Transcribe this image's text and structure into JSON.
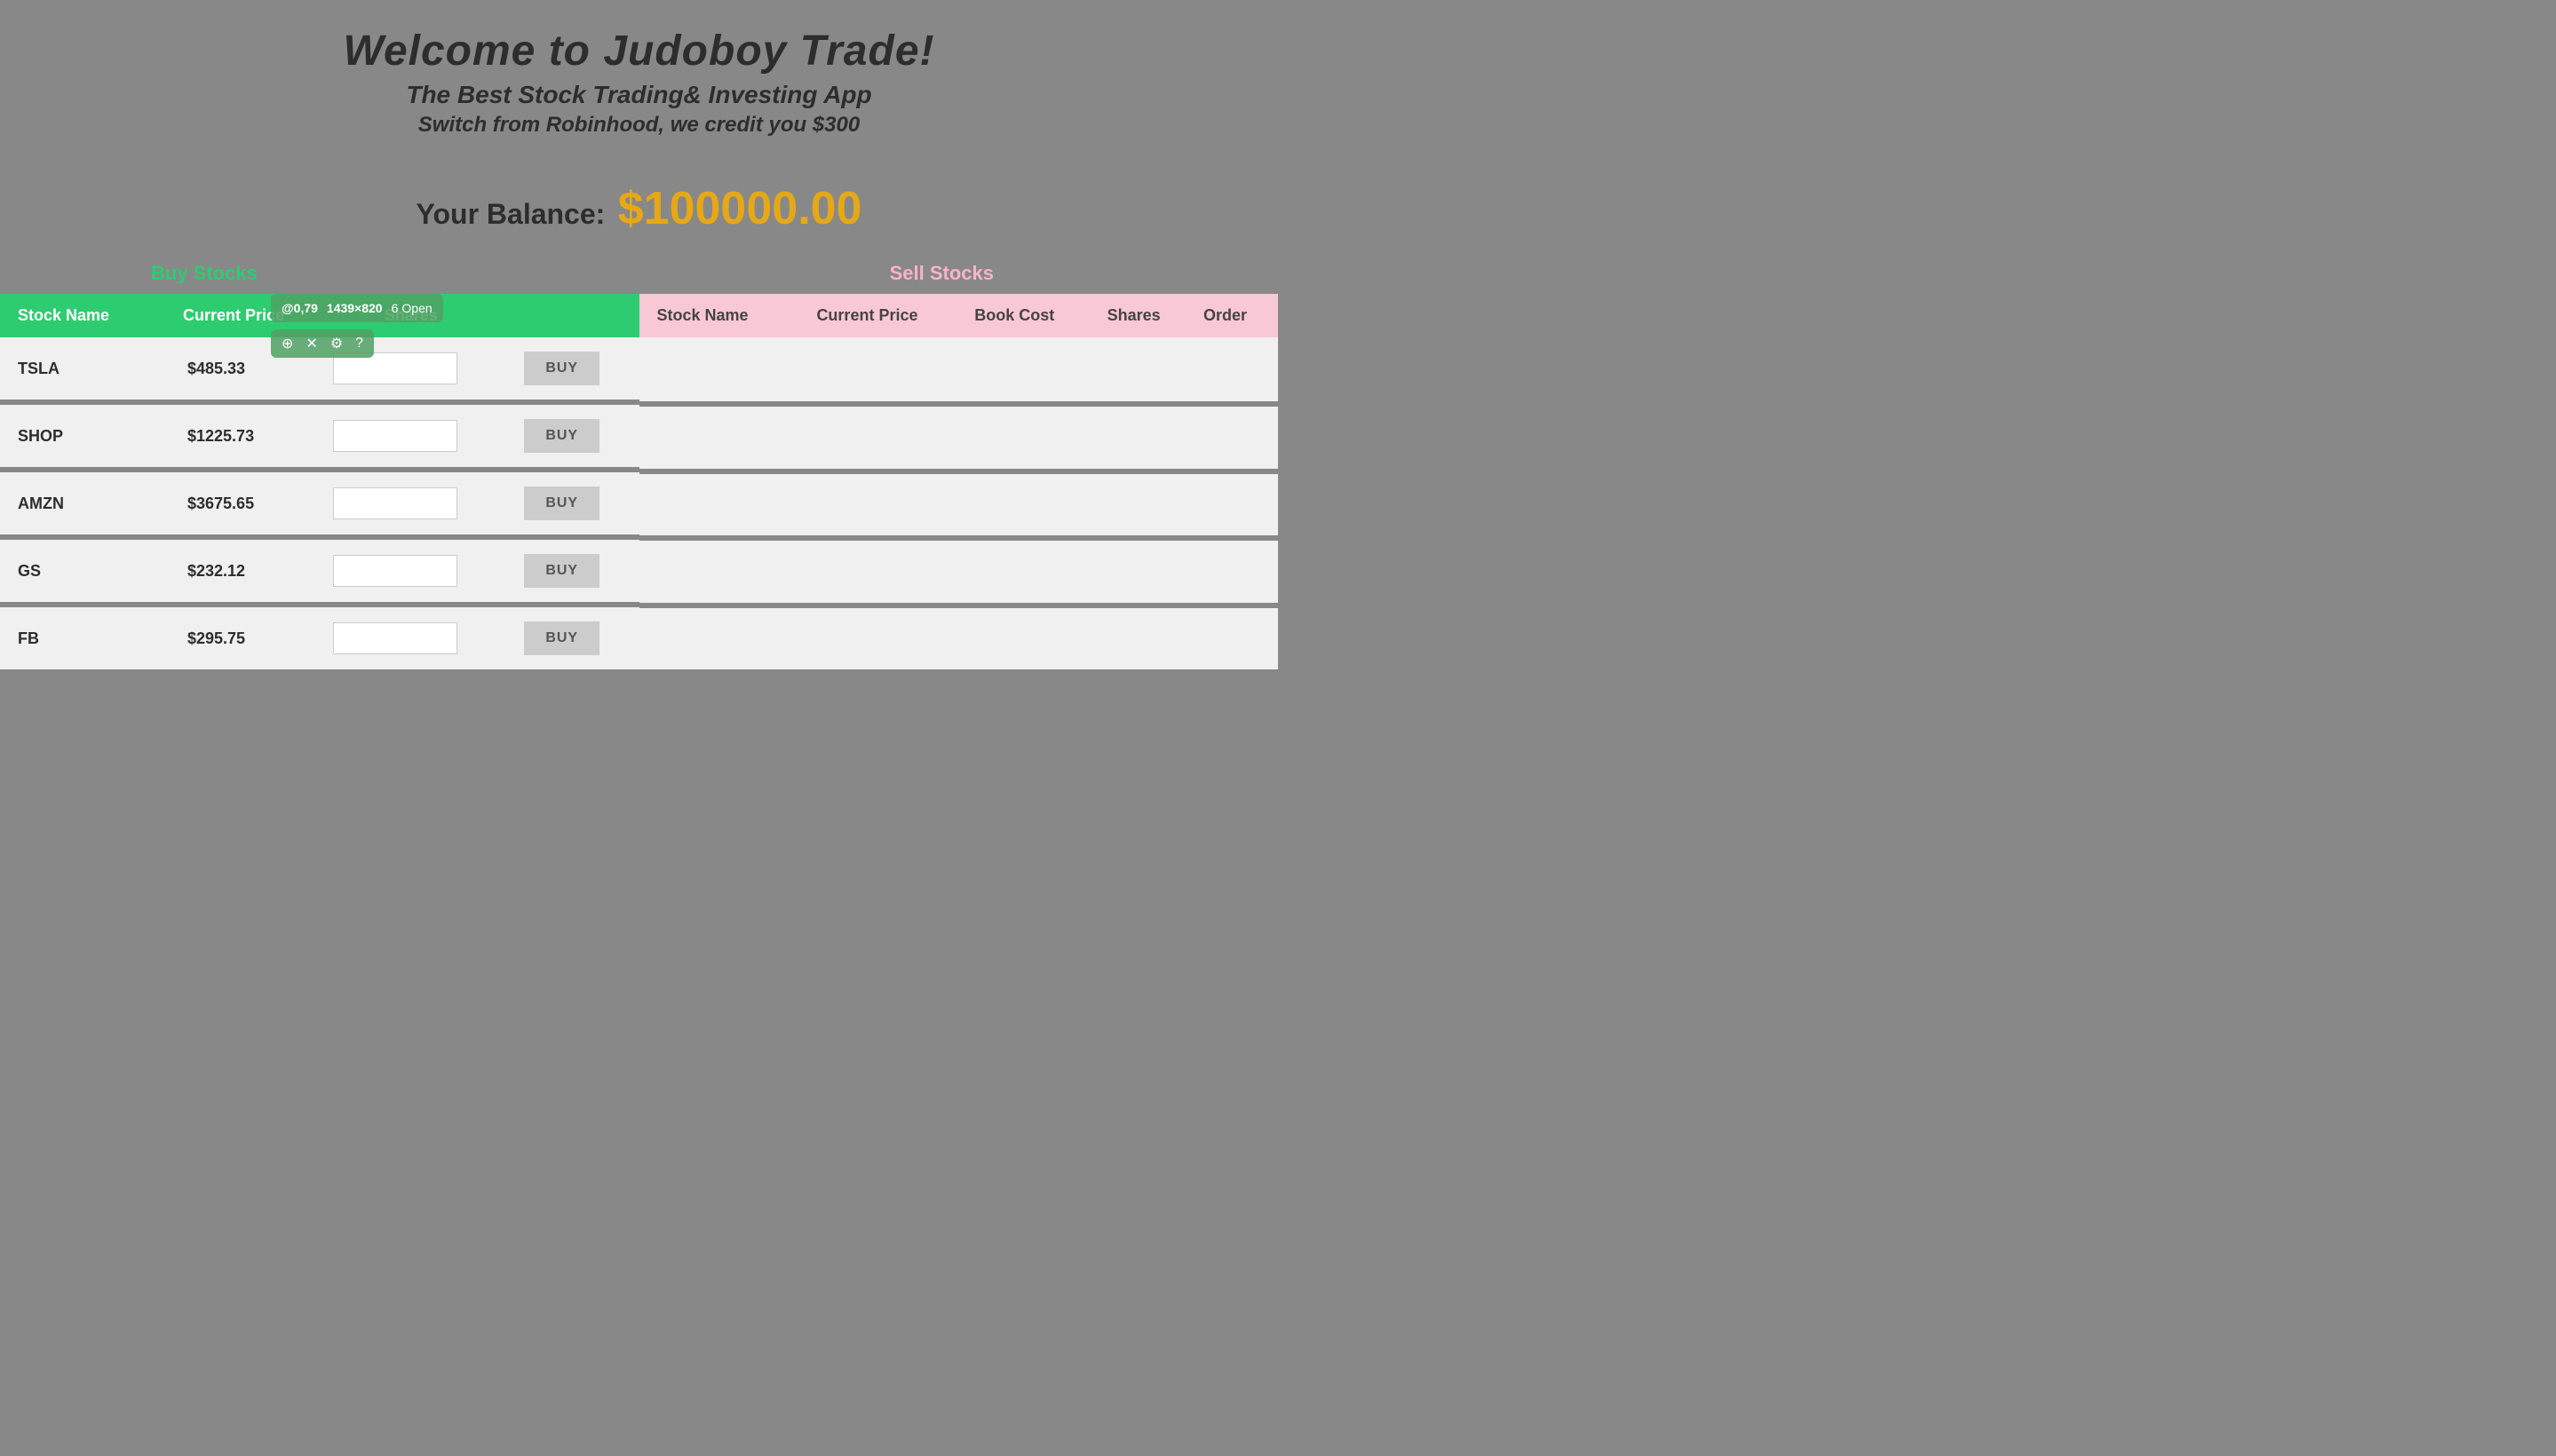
{
  "header": {
    "title": "Welcome to Judoboy Trade!",
    "subtitle": "The Best Stock Trading& Investing App",
    "promo": "Switch from Robinhood, we credit you $300"
  },
  "balance": {
    "label": "Your Balance:",
    "amount": "$100000.00"
  },
  "buy_section": {
    "label": "Buy Stocks",
    "headers": [
      "Stock Name",
      "Current Price",
      "Shares",
      ""
    ],
    "rows": [
      {
        "name": "TSLA",
        "price": "$485.33"
      },
      {
        "name": "SHOP",
        "price": "$1225.73"
      },
      {
        "name": "AMZN",
        "price": "$3675.65"
      },
      {
        "name": "GS",
        "price": "$232.12"
      },
      {
        "name": "FB",
        "price": "$295.75"
      }
    ],
    "buy_button_label": "BUY"
  },
  "sell_section": {
    "label": "Sell Stocks",
    "headers": [
      "Stock Name",
      "Current Price",
      "Book Cost",
      "Shares",
      "Order"
    ]
  },
  "inspector": {
    "coords": "@0,79",
    "size": "1439×820",
    "open_count": "6",
    "open_label": "Open"
  }
}
